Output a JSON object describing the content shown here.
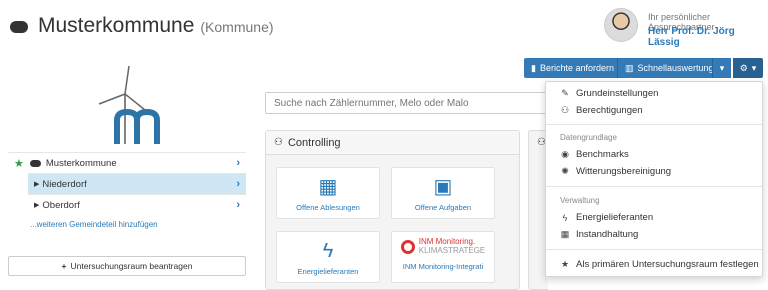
{
  "header": {
    "title": "Musterkommune",
    "subtitle": "(Kommune)",
    "contact_caption": "Ihr persönlicher Ansprechpartner",
    "contact_name": "Herr Prof. Dr. Jörg Lässig"
  },
  "toolbar": {
    "reports_label": "Berichte anfordern",
    "quick_label": "Schnellauswertungen",
    "caret": "▾",
    "settings_caret": "▾"
  },
  "search": {
    "placeholder": "Suche nach Zählernummer, Melo oder Malo"
  },
  "tree": {
    "root": "Musterkommune",
    "children": [
      "Niederdorf",
      "Oberdorf"
    ],
    "add_link": "...weiteren Gemeindeteil hinzufügen",
    "request_button": "Untersuchungsraum beantragen"
  },
  "controlling": {
    "title": "Controlling",
    "tiles": [
      {
        "label": "Offene Ablesungen",
        "icon": "calendar-refresh-icon"
      },
      {
        "label": "Offene Aufgaben",
        "icon": "calendar-alert-icon"
      },
      {
        "label": "Energielieferanten",
        "icon": "bolt-icon"
      },
      {
        "label": "INM Monitoring-Integrati",
        "icon": "inm-logo",
        "brand_line1": "INM Monitoring.",
        "brand_line2": "KLIMASTRATEGE"
      }
    ]
  },
  "menu": {
    "items_top": [
      "Grundeinstellungen",
      "Berechtigungen"
    ],
    "section1_header": "Datengrundlage",
    "section1_items": [
      "Benchmarks",
      "Witterungsbereinigung"
    ],
    "section2_header": "Verwaltung",
    "section2_items": [
      "Energielieferanten",
      "Instandhaltung"
    ],
    "footer_item": "Als primären Untersuchungsraum festlegen"
  },
  "colors": {
    "accent": "#337ab7",
    "selected_row": "#cfe6f4",
    "star": "#2e9e3f"
  }
}
